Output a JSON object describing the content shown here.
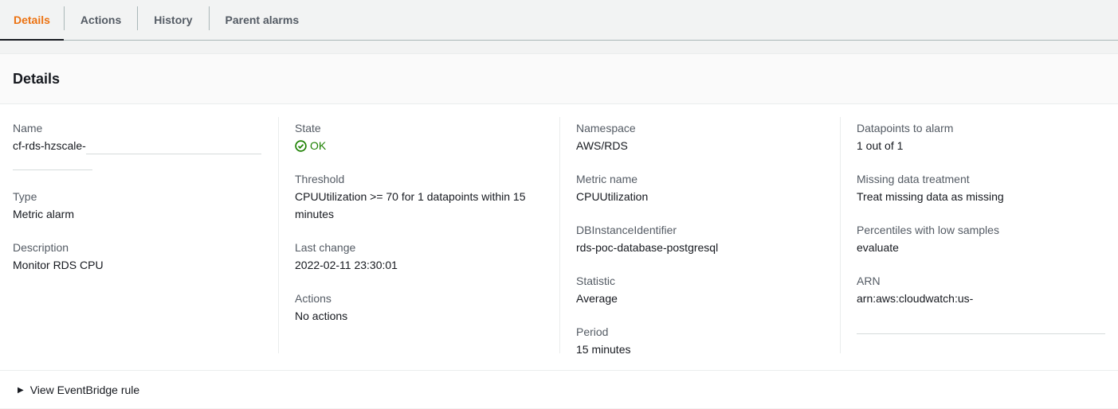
{
  "tabs": [
    {
      "label": "Details"
    },
    {
      "label": "Actions"
    },
    {
      "label": "History"
    },
    {
      "label": "Parent alarms"
    }
  ],
  "panel": {
    "title": "Details"
  },
  "fields": {
    "name": {
      "label": "Name",
      "value": "cf-rds-hzscale-"
    },
    "type": {
      "label": "Type",
      "value": "Metric alarm"
    },
    "description": {
      "label": "Description",
      "value": "Monitor RDS CPU"
    },
    "state": {
      "label": "State",
      "value": "OK"
    },
    "threshold": {
      "label": "Threshold",
      "value": "CPUUtilization >= 70 for 1 datapoints within 15 minutes"
    },
    "last_change": {
      "label": "Last change",
      "value": "2022-02-11 23:30:01"
    },
    "actions": {
      "label": "Actions",
      "value": "No actions"
    },
    "namespace": {
      "label": "Namespace",
      "value": "AWS/RDS"
    },
    "metric_name": {
      "label": "Metric name",
      "value": "CPUUtilization"
    },
    "dbinstance": {
      "label": "DBInstanceIdentifier",
      "value": "rds-poc-database-postgresql"
    },
    "statistic": {
      "label": "Statistic",
      "value": "Average"
    },
    "period": {
      "label": "Period",
      "value": "15 minutes"
    },
    "datapoints": {
      "label": "Datapoints to alarm",
      "value": "1 out of 1"
    },
    "missing": {
      "label": "Missing data treatment",
      "value": "Treat missing data as missing"
    },
    "percentiles": {
      "label": "Percentiles with low samples",
      "value": "evaluate"
    },
    "arn": {
      "label": "ARN",
      "value": "arn:aws:cloudwatch:us-"
    }
  },
  "footer": {
    "expander_label": "View EventBridge rule"
  },
  "colors": {
    "accent": "#ec7211",
    "ok": "#1d8102"
  }
}
